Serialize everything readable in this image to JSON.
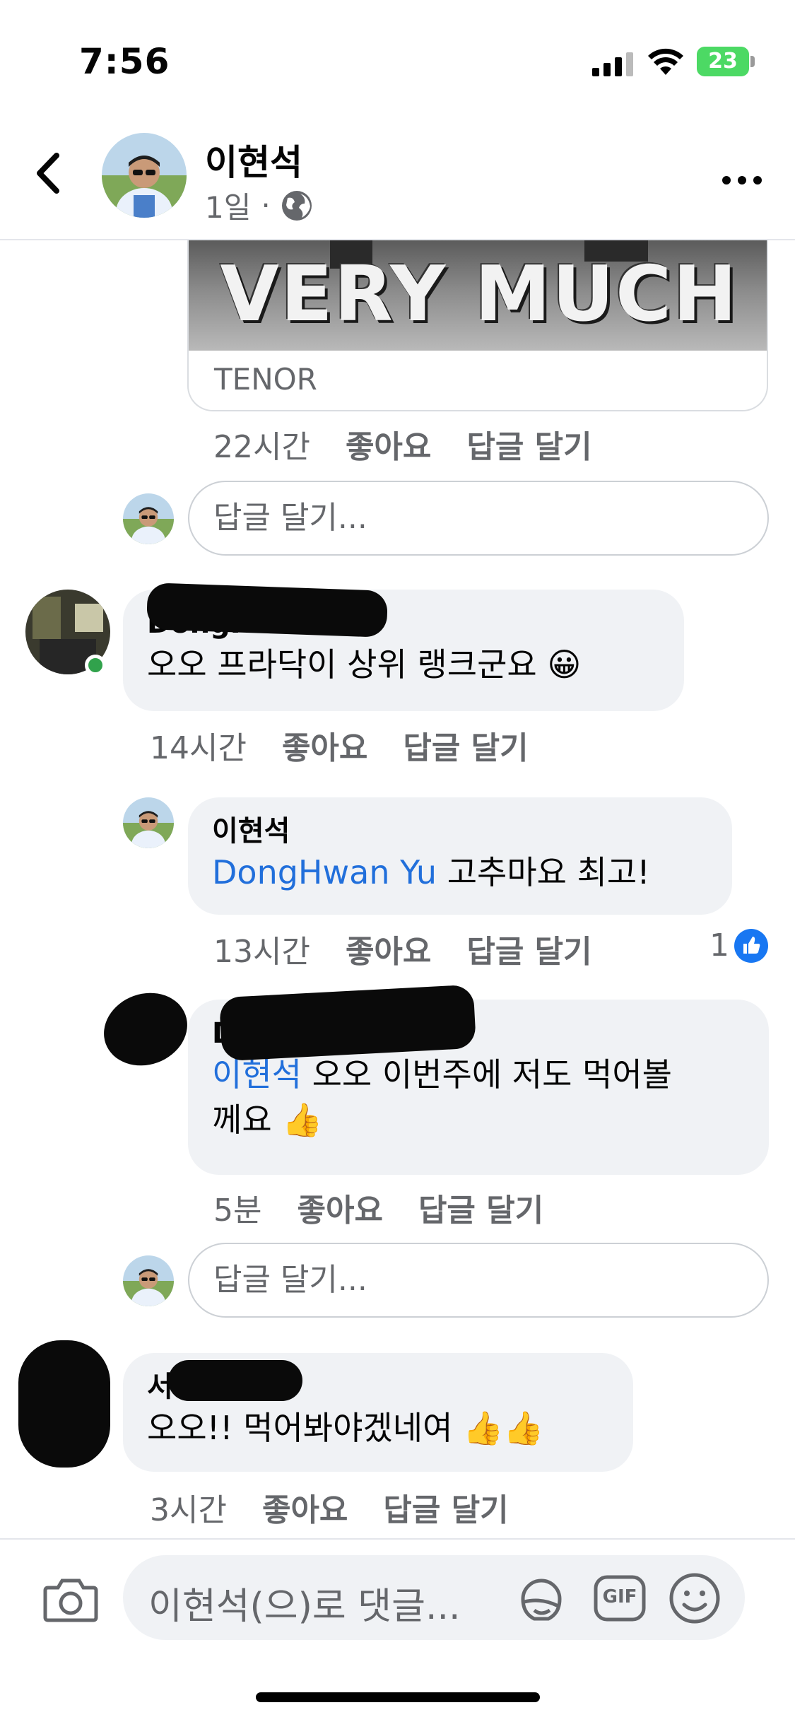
{
  "status_bar": {
    "time": "7:56",
    "battery": "23"
  },
  "header": {
    "author_name": "이현석",
    "post_age": "1일",
    "separator": "·",
    "icons": [
      "back-chevron-icon",
      "globe-icon",
      "more-dots-icon"
    ]
  },
  "gif_card": {
    "text": "VERY MUCH",
    "source": "TENOR"
  },
  "actions": {
    "like": "좋아요",
    "reply": "답글 달기"
  },
  "reply_placeholder": "답글 달기...",
  "comments": [
    {
      "id": "gif-reply",
      "time": "22시간"
    },
    {
      "id": "c1",
      "author": "DongHwan Yu",
      "text": "오오 프라닥이 상위 랭크군요 😀",
      "time": "14시간",
      "author_online": true
    },
    {
      "id": "r1",
      "author": "이현석",
      "mention": "DongHwan Yu",
      "text": " 고추마요 최고!",
      "time": "13시간",
      "like_count": "1"
    },
    {
      "id": "r2",
      "author": "DongHwan Yu",
      "mention": "이현석",
      "text_line1": " 오오 이번주에 저도 먹어볼",
      "text_line2": "께요 👍",
      "time": "5분"
    },
    {
      "id": "c2",
      "author": "서민주",
      "text": "오오!! 먹어봐야겠네여 👍👍",
      "time": "3시간"
    }
  ],
  "composer": {
    "placeholder": "이현석(으)로 댓글...",
    "gif_label": "GIF",
    "icons": [
      "camera-icon",
      "sticker-icon",
      "gif-icon",
      "emoji-icon"
    ]
  },
  "colors": {
    "mention": "#216fdb",
    "bubble": "#f0f2f5",
    "online": "#31a24c",
    "like": "#1877f2",
    "battery": "#4cd964"
  }
}
